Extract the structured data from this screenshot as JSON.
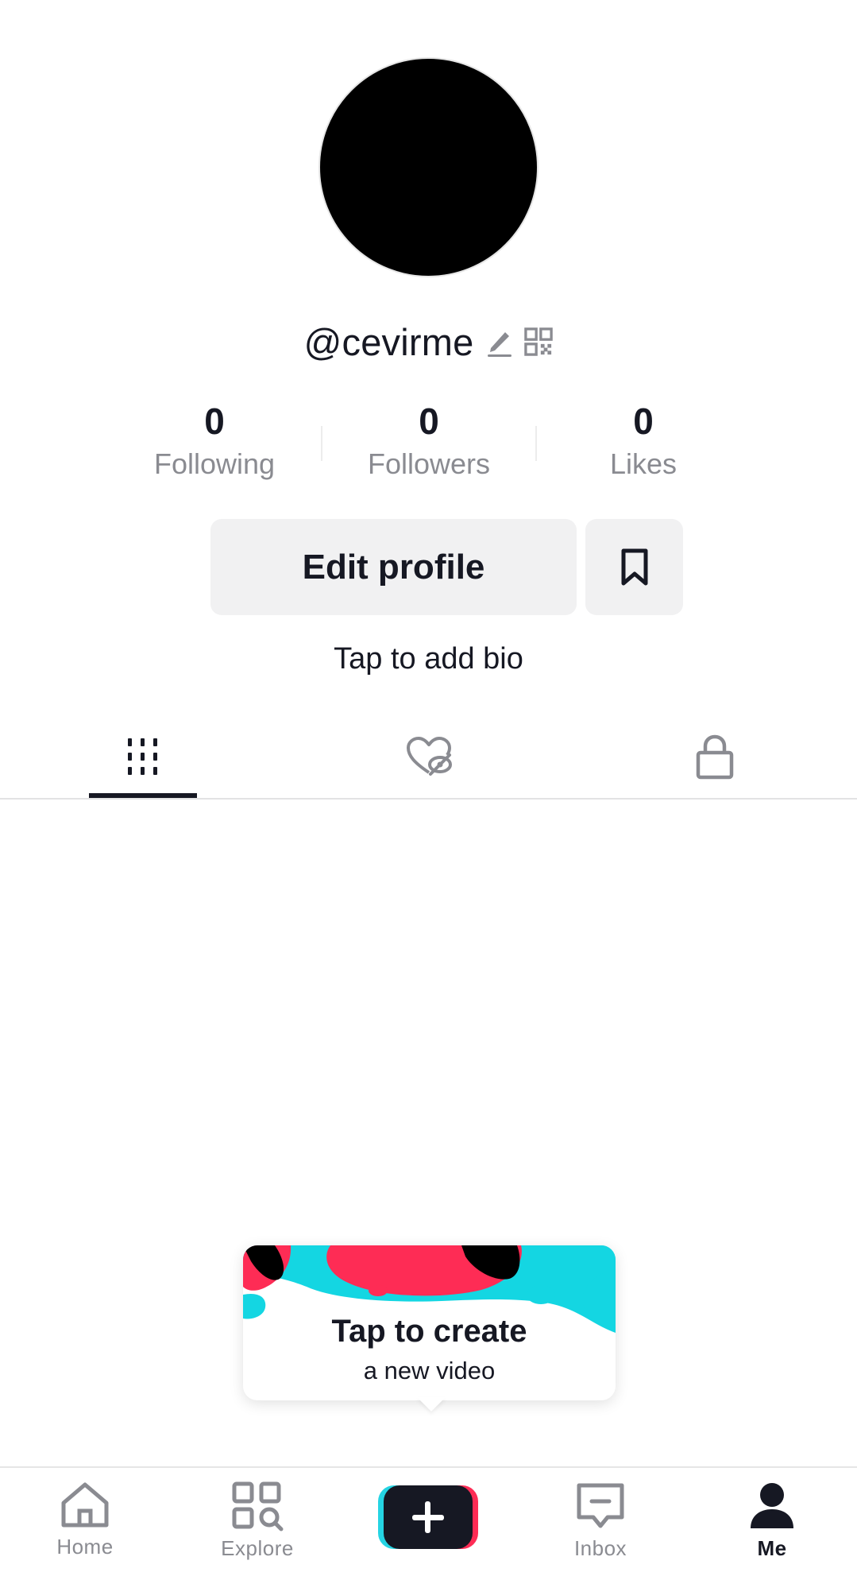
{
  "profile": {
    "username": "@cevirme",
    "stats": [
      {
        "value": "0",
        "label": "Following"
      },
      {
        "value": "0",
        "label": "Followers"
      },
      {
        "value": "0",
        "label": "Likes"
      }
    ],
    "edit_label": "Edit profile",
    "bio_prompt": "Tap to add bio"
  },
  "tabs": [
    {
      "icon": "grid-icon",
      "active": true
    },
    {
      "icon": "liked-hidden-icon",
      "active": false
    },
    {
      "icon": "lock-icon",
      "active": false
    }
  ],
  "tooltip": {
    "line1": "Tap to create",
    "line2": "a new video"
  },
  "nav": {
    "home": "Home",
    "explore": "Explore",
    "inbox": "Inbox",
    "me": "Me"
  },
  "colors": {
    "accent_red": "#fe2c55",
    "accent_cyan": "#25f4ee",
    "text_primary": "#161823",
    "text_secondary": "#8a8b91"
  }
}
